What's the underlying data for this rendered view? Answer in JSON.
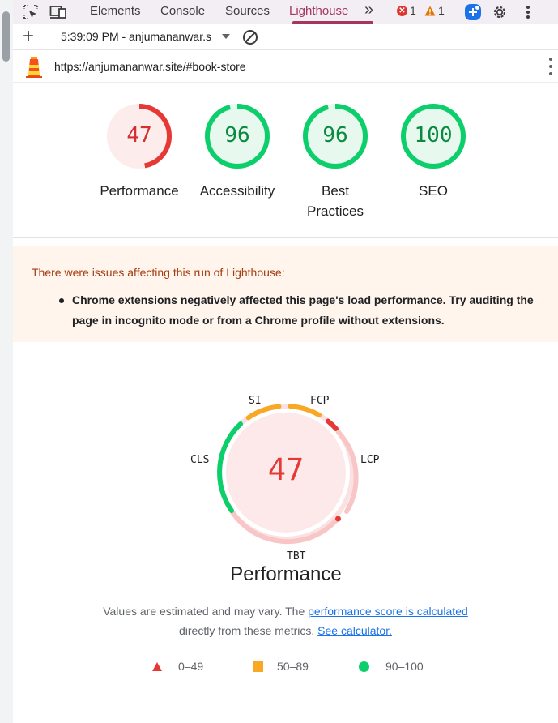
{
  "tabbar": {
    "tabs": [
      "Elements",
      "Console",
      "Sources",
      "Lighthouse"
    ],
    "active_tab": "Lighthouse",
    "more_tabs_glyph": "»",
    "error_count": "1",
    "warning_count": "1"
  },
  "toolbar": {
    "new_report_glyph": "+",
    "report_select_value": "5:39:09 PM - anjumananwar.s",
    "clear_icon": "block-icon"
  },
  "url_row": {
    "url": "https://anjumananwar.site/#book-store"
  },
  "scores": [
    {
      "label": "Performance",
      "score": 47,
      "score_text": "47",
      "color": "#e53935",
      "bg": "#fdecec"
    },
    {
      "label": "Accessibility",
      "score": 96,
      "score_text": "96",
      "color": "#0cce6b",
      "bg": "#e7f8ee"
    },
    {
      "label": "Best Practices",
      "label_line1": "Best",
      "label_line2": "Practices",
      "score": 96,
      "score_text": "96",
      "color": "#0cce6b",
      "bg": "#e7f8ee"
    },
    {
      "label": "SEO",
      "score": 100,
      "score_text": "100",
      "color": "#0cce6b",
      "bg": "#e7f8ee"
    }
  ],
  "warning": {
    "title": "There were issues affecting this run of Lighthouse:",
    "items": [
      "Chrome extensions negatively affected this page's load performance. Try auditing the page in incognito mode or from a Chrome profile without extensions."
    ]
  },
  "performance_gauge": {
    "score_text": "47",
    "title": "Performance",
    "metrics": [
      "SI",
      "FCP",
      "LCP",
      "TBT",
      "CLS"
    ]
  },
  "note": {
    "text_before": "Values are estimated and may vary. The ",
    "link1": "performance score is calculated",
    "text_middle": "directly from these metrics.",
    "link2": "See calculator."
  },
  "legend": [
    {
      "shape": "triangle",
      "color": "#e53935",
      "range": "0–49"
    },
    {
      "shape": "square",
      "color": "#f9a825",
      "range": "50–89"
    },
    {
      "shape": "circle",
      "color": "#0cce6b",
      "range": "90–100"
    }
  ],
  "colors": {
    "fail": "#e53935",
    "average": "#f9a825",
    "pass": "#0cce6b",
    "accent": "#a5365d",
    "link": "#1a73e8"
  }
}
